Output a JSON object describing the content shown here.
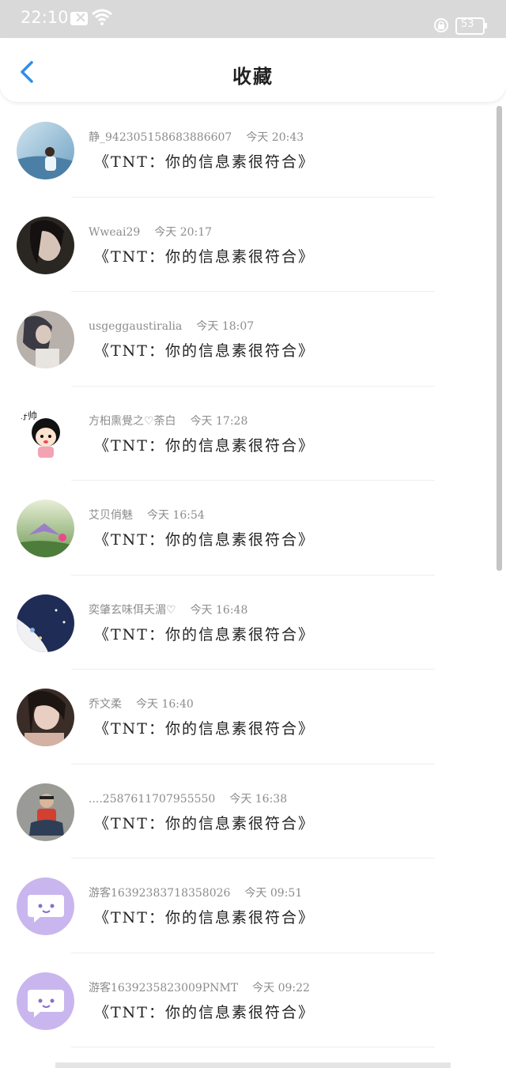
{
  "status_bar": {
    "time": "22:10",
    "battery": "53"
  },
  "header": {
    "title": "收藏"
  },
  "accent_color": "#2f8fe6",
  "items": [
    {
      "name": "静_94230515868388660​7",
      "date": "今天 20:43",
      "message": "《TNT：你的信息素很符合》"
    },
    {
      "name": "Wweai29",
      "date": "今天 20:17",
      "message": "《TNT：你的信息素很符合》"
    },
    {
      "name": "usgeggaustiralia",
      "date": "今天 18:07",
      "message": "《TNT：你的信息素很符合》"
    },
    {
      "name": "方桕熏覺之♡荼白",
      "date": "今天 17:28",
      "message": "《TNT：你的信息素很符合》"
    },
    {
      "name": "艾贝俏魅",
      "date": "今天 16:54",
      "message": "《TNT：你的信息素很符合》"
    },
    {
      "name": "奕肇玄味佴夭湄♡",
      "date": "今天 16:48",
      "message": "《TNT：你的信息素很符合》"
    },
    {
      "name": "乔文柔",
      "date": "今天 16:40",
      "message": "《TNT：你的信息素很符合》"
    },
    {
      "name": "....2587611707955550",
      "date": "今天 16:38",
      "message": "《TNT：你的信息素很符合》"
    },
    {
      "name": "游客1639238371835802​6",
      "date": "今天 09:51",
      "message": "《TNT：你的信息素很符合》"
    },
    {
      "name": "游客1639235823009PNMT",
      "date": "今天 09:22",
      "message": "《TNT：你的信息素很符合》"
    }
  ],
  "avatar_cartoon_text": "好帅"
}
